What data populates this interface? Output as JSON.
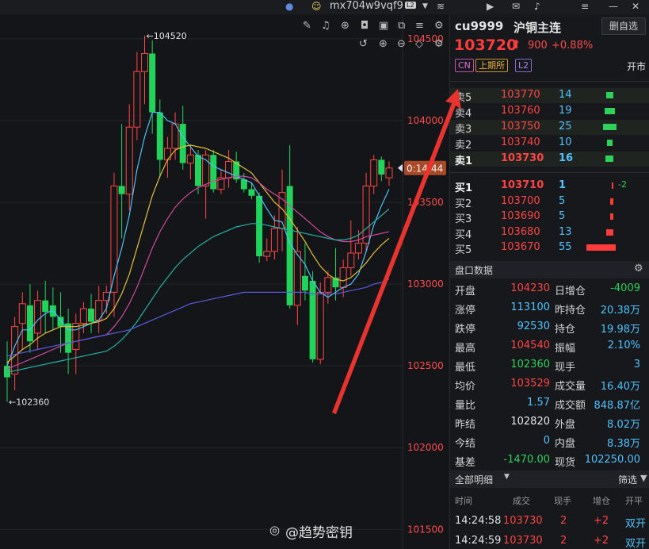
{
  "topbar": {
    "account": "mx704w9vqf9",
    "level_badge": "L2",
    "icons": [
      "avatar-icon",
      "user-icon",
      "dropdown-icon",
      "layers-icon",
      "play-icon",
      "mail-icon",
      "bell-icon",
      "menu-icon",
      "minimize-icon",
      "close-icon"
    ]
  },
  "chart_tools": {
    "icons": [
      "draw-icon",
      "alert-icon",
      "indicator-icon",
      "screenshot-icon",
      "window-icon",
      "copy-icon",
      "compare-icon",
      "undo-icon",
      "zoom-in-icon",
      "zoom-out-icon",
      "more-icon",
      "settings-icon"
    ]
  },
  "chart_data": {
    "type": "candlestick",
    "y_ticks": [
      104500,
      104000,
      103500,
      103000,
      102500,
      102000,
      101500
    ],
    "ylim": [
      101380,
      104650
    ],
    "high_label": "104520",
    "low_label": "102360",
    "price_tag": "0:14:44",
    "candles": [
      {
        "o": 102500,
        "h": 102650,
        "l": 102280,
        "c": 102430
      },
      {
        "o": 102450,
        "h": 102800,
        "l": 102350,
        "c": 102740
      },
      {
        "o": 102760,
        "h": 102950,
        "l": 102600,
        "c": 102880
      },
      {
        "o": 102870,
        "h": 103000,
        "l": 102580,
        "c": 102650
      },
      {
        "o": 102700,
        "h": 102960,
        "l": 102600,
        "c": 102900
      },
      {
        "o": 102900,
        "h": 103020,
        "l": 102700,
        "c": 102830
      },
      {
        "o": 102870,
        "h": 102980,
        "l": 102720,
        "c": 102800
      },
      {
        "o": 102800,
        "h": 102950,
        "l": 102580,
        "c": 102740
      },
      {
        "o": 102760,
        "h": 102850,
        "l": 102450,
        "c": 102580
      },
      {
        "o": 102600,
        "h": 102820,
        "l": 102450,
        "c": 102760
      },
      {
        "o": 102760,
        "h": 102890,
        "l": 102700,
        "c": 102850
      },
      {
        "o": 102850,
        "h": 102940,
        "l": 102700,
        "c": 102770
      },
      {
        "o": 102780,
        "h": 102990,
        "l": 102700,
        "c": 102900
      },
      {
        "o": 102900,
        "h": 102990,
        "l": 102820,
        "c": 102950
      },
      {
        "o": 102950,
        "h": 103680,
        "l": 102800,
        "c": 103600
      },
      {
        "o": 103600,
        "h": 103980,
        "l": 103280,
        "c": 103550
      },
      {
        "o": 103550,
        "h": 104100,
        "l": 103450,
        "c": 103960
      },
      {
        "o": 103960,
        "h": 104420,
        "l": 103880,
        "c": 104300
      },
      {
        "o": 104300,
        "h": 104520,
        "l": 104100,
        "c": 104410
      },
      {
        "o": 104410,
        "h": 104490,
        "l": 103920,
        "c": 104050
      },
      {
        "o": 104050,
        "h": 104130,
        "l": 103650,
        "c": 103760
      },
      {
        "o": 103760,
        "h": 103900,
        "l": 103650,
        "c": 103830
      },
      {
        "o": 103830,
        "h": 104050,
        "l": 103760,
        "c": 103980
      },
      {
        "o": 103980,
        "h": 104090,
        "l": 103700,
        "c": 103740
      },
      {
        "o": 103740,
        "h": 103850,
        "l": 103640,
        "c": 103790
      },
      {
        "o": 103790,
        "h": 103820,
        "l": 103550,
        "c": 103600
      },
      {
        "o": 103600,
        "h": 103820,
        "l": 103400,
        "c": 103790
      },
      {
        "o": 103790,
        "h": 103820,
        "l": 103560,
        "c": 103580
      },
      {
        "o": 103580,
        "h": 103700,
        "l": 103550,
        "c": 103650
      },
      {
        "o": 103650,
        "h": 103820,
        "l": 103590,
        "c": 103750
      },
      {
        "o": 103750,
        "h": 103810,
        "l": 103620,
        "c": 103640
      },
      {
        "o": 103640,
        "h": 103680,
        "l": 103560,
        "c": 103580
      },
      {
        "o": 103580,
        "h": 103620,
        "l": 103520,
        "c": 103540
      },
      {
        "o": 103540,
        "h": 103560,
        "l": 103130,
        "c": 103170
      },
      {
        "o": 103170,
        "h": 103280,
        "l": 103140,
        "c": 103200
      },
      {
        "o": 103200,
        "h": 103420,
        "l": 103150,
        "c": 103340
      },
      {
        "o": 103340,
        "h": 103700,
        "l": 103200,
        "c": 103560
      },
      {
        "o": 103600,
        "h": 103850,
        "l": 102850,
        "c": 102870
      },
      {
        "o": 102870,
        "h": 103350,
        "l": 102750,
        "c": 103200
      },
      {
        "o": 103050,
        "h": 103250,
        "l": 102900,
        "c": 102960
      },
      {
        "o": 103020,
        "h": 103080,
        "l": 102520,
        "c": 102540
      },
      {
        "o": 102540,
        "h": 103010,
        "l": 102510,
        "c": 102950
      },
      {
        "o": 102950,
        "h": 103080,
        "l": 102880,
        "c": 103040
      },
      {
        "o": 103040,
        "h": 103220,
        "l": 102900,
        "c": 102980
      },
      {
        "o": 102980,
        "h": 103150,
        "l": 102920,
        "c": 103100
      },
      {
        "o": 103100,
        "h": 103390,
        "l": 103050,
        "c": 103190
      },
      {
        "o": 103190,
        "h": 103330,
        "l": 103150,
        "c": 103250
      },
      {
        "o": 103250,
        "h": 103680,
        "l": 103200,
        "c": 103600
      },
      {
        "o": 103600,
        "h": 103790,
        "l": 103550,
        "c": 103760
      },
      {
        "o": 103760,
        "h": 103780,
        "l": 103630,
        "c": 103670
      },
      {
        "o": 103650,
        "h": 103750,
        "l": 103600,
        "c": 103710
      }
    ],
    "ma_lines": [
      {
        "color": "#4dc3f7",
        "values": [
          102500,
          102620,
          102720,
          102720,
          102780,
          102820,
          102840,
          102780,
          102720,
          102720,
          102740,
          102760,
          102780,
          102850,
          103050,
          103220,
          103420,
          103700,
          103900,
          104050,
          104050,
          104000,
          103980,
          103900,
          103840,
          103780,
          103760,
          103720,
          103700,
          103680,
          103660,
          103640,
          103620,
          103540,
          103460,
          103390,
          103380,
          103250,
          103180,
          103120,
          103020,
          102950,
          102920,
          102950,
          102980,
          103000,
          103060,
          103200,
          103360,
          103480,
          103580
        ]
      },
      {
        "color": "#e0c238",
        "values": [
          102520,
          102560,
          102600,
          102630,
          102670,
          102700,
          102720,
          102740,
          102740,
          102740,
          102750,
          102760,
          102770,
          102790,
          102850,
          102940,
          103060,
          103220,
          103380,
          103540,
          103660,
          103760,
          103820,
          103840,
          103850,
          103840,
          103830,
          103810,
          103790,
          103770,
          103740,
          103710,
          103680,
          103620,
          103560,
          103500,
          103460,
          103400,
          103330,
          103260,
          103180,
          103110,
          103060,
          103030,
          103020,
          103040,
          103080,
          103130,
          103190,
          103240,
          103280
        ]
      },
      {
        "color": "#d24a9e",
        "values": [
          102480,
          102500,
          102520,
          102540,
          102560,
          102580,
          102600,
          102620,
          102640,
          102650,
          102660,
          102670,
          102680,
          102690,
          102740,
          102800,
          102880,
          102980,
          103100,
          103220,
          103320,
          103400,
          103470,
          103520,
          103560,
          103590,
          103610,
          103630,
          103640,
          103650,
          103660,
          103660,
          103650,
          103620,
          103580,
          103550,
          103520,
          103480,
          103440,
          103400,
          103360,
          103320,
          103290,
          103270,
          103260,
          103260,
          103270,
          103290,
          103300,
          103310,
          103320
        ]
      },
      {
        "color": "#26b3a6",
        "values": [
          102460,
          102470,
          102480,
          102490,
          102500,
          102510,
          102520,
          102530,
          102540,
          102550,
          102560,
          102570,
          102580,
          102590,
          102620,
          102660,
          102710,
          102770,
          102840,
          102910,
          102980,
          103040,
          103100,
          103150,
          103190,
          103230,
          103260,
          103290,
          103310,
          103330,
          103350,
          103360,
          103370,
          103370,
          103360,
          103350,
          103340,
          103330,
          103320,
          103310,
          103300,
          103290,
          103280,
          103270,
          103270,
          103280,
          103300,
          103340,
          103380,
          103420,
          103460
        ]
      },
      {
        "color": "#5a5ce0",
        "values": [
          102560,
          102570,
          102580,
          102590,
          102600,
          102610,
          102620,
          102630,
          102640,
          102650,
          102660,
          102670,
          102680,
          102690,
          102700,
          102710,
          102720,
          102740,
          102760,
          102780,
          102800,
          102820,
          102840,
          102860,
          102880,
          102890,
          102900,
          102910,
          102920,
          102930,
          102940,
          102950,
          102950,
          102950,
          102950,
          102950,
          102950,
          102950,
          102950,
          102950,
          102940,
          102940,
          102940,
          102940,
          102950,
          102960,
          102970,
          102980,
          103000,
          103010,
          103030
        ]
      }
    ]
  },
  "quote": {
    "code": "cu9999",
    "name": "沪铜主连",
    "delete_btn": "删自选",
    "last": "103720",
    "change": "900",
    "change_pct": "+0.88%",
    "tag_cn": "CN",
    "tag_exchange": "上期所",
    "tag_l2": "L2",
    "status": "开市"
  },
  "orderbook": {
    "asks": [
      {
        "label": "卖5",
        "price": "103770",
        "vol": "14",
        "bar": 0.12
      },
      {
        "label": "卖4",
        "price": "103760",
        "vol": "19",
        "bar": 0.17
      },
      {
        "label": "卖3",
        "price": "103750",
        "vol": "25",
        "bar": 0.23
      },
      {
        "label": "卖2",
        "price": "103740",
        "vol": "10",
        "bar": 0.09
      },
      {
        "label": "卖1",
        "price": "103730",
        "vol": "16",
        "bar": 0.14
      }
    ],
    "bids": [
      {
        "label": "买1",
        "price": "103710",
        "vol": "1",
        "bar": 0.01,
        "delta": "-2"
      },
      {
        "label": "买2",
        "price": "103700",
        "vol": "5",
        "bar": 0.05
      },
      {
        "label": "买3",
        "price": "103690",
        "vol": "5",
        "bar": 0.05
      },
      {
        "label": "买4",
        "price": "103680",
        "vol": "13",
        "bar": 0.12
      },
      {
        "label": "买5",
        "price": "103670",
        "vol": "55",
        "bar": 0.5
      }
    ]
  },
  "pankou": {
    "title": "盘口数据",
    "rows": [
      {
        "l1": "开盘",
        "v1": "104230",
        "c1": "#ff4444",
        "l2": "日增仓",
        "v2": "-4009",
        "c2": "#2ed15a"
      },
      {
        "l1": "涨停",
        "v1": "113100",
        "c1": "#4fc3ff",
        "l2": "昨持仓",
        "v2": "20.38万",
        "c2": "#4fc3ff"
      },
      {
        "l1": "跌停",
        "v1": "92530",
        "c1": "#4fc3ff",
        "l2": "持仓",
        "v2": "19.98万",
        "c2": "#4fc3ff"
      },
      {
        "l1": "最高",
        "v1": "104540",
        "c1": "#ff4444",
        "l2": "振幅",
        "v2": "2.10%",
        "c2": "#4fc3ff"
      },
      {
        "l1": "最低",
        "v1": "102360",
        "c1": "#2ed15a",
        "l2": "现手",
        "v2": "3",
        "c2": "#4fc3ff"
      },
      {
        "l1": "均价",
        "v1": "103529",
        "c1": "#ff4444",
        "l2": "成交量",
        "v2": "16.40万",
        "c2": "#4fc3ff"
      },
      {
        "l1": "量比",
        "v1": "1.57",
        "c1": "#4fc3ff",
        "l2": "成交额",
        "v2": "848.87亿",
        "c2": "#4fc3ff"
      },
      {
        "l1": "昨结",
        "v1": "102820",
        "c1": "#e8e8e8",
        "l2": "外盘",
        "v2": "8.02万",
        "c2": "#4fc3ff"
      },
      {
        "l1": "今结",
        "v1": "0",
        "c1": "#4fc3ff",
        "l2": "内盘",
        "v2": "8.38万",
        "c2": "#4fc3ff"
      },
      {
        "l1": "基差",
        "v1": "-1470.00",
        "c1": "#2ed15a",
        "l2": "现货",
        "v2": "102250.00",
        "c2": "#4fc3ff"
      }
    ]
  },
  "trades": {
    "title": "全部明细",
    "filter": "筛选",
    "headers": [
      "时间",
      "成交",
      "现手",
      "增仓",
      "开平"
    ],
    "rows": [
      {
        "time": "14:24:58",
        "price": "103730",
        "vol": "2",
        "oi": "+2",
        "type": "双开"
      },
      {
        "time": "14:24:59",
        "price": "103730",
        "vol": "2",
        "oi": "+2",
        "type": "双开"
      }
    ]
  },
  "watermark": "@趋势密钥"
}
